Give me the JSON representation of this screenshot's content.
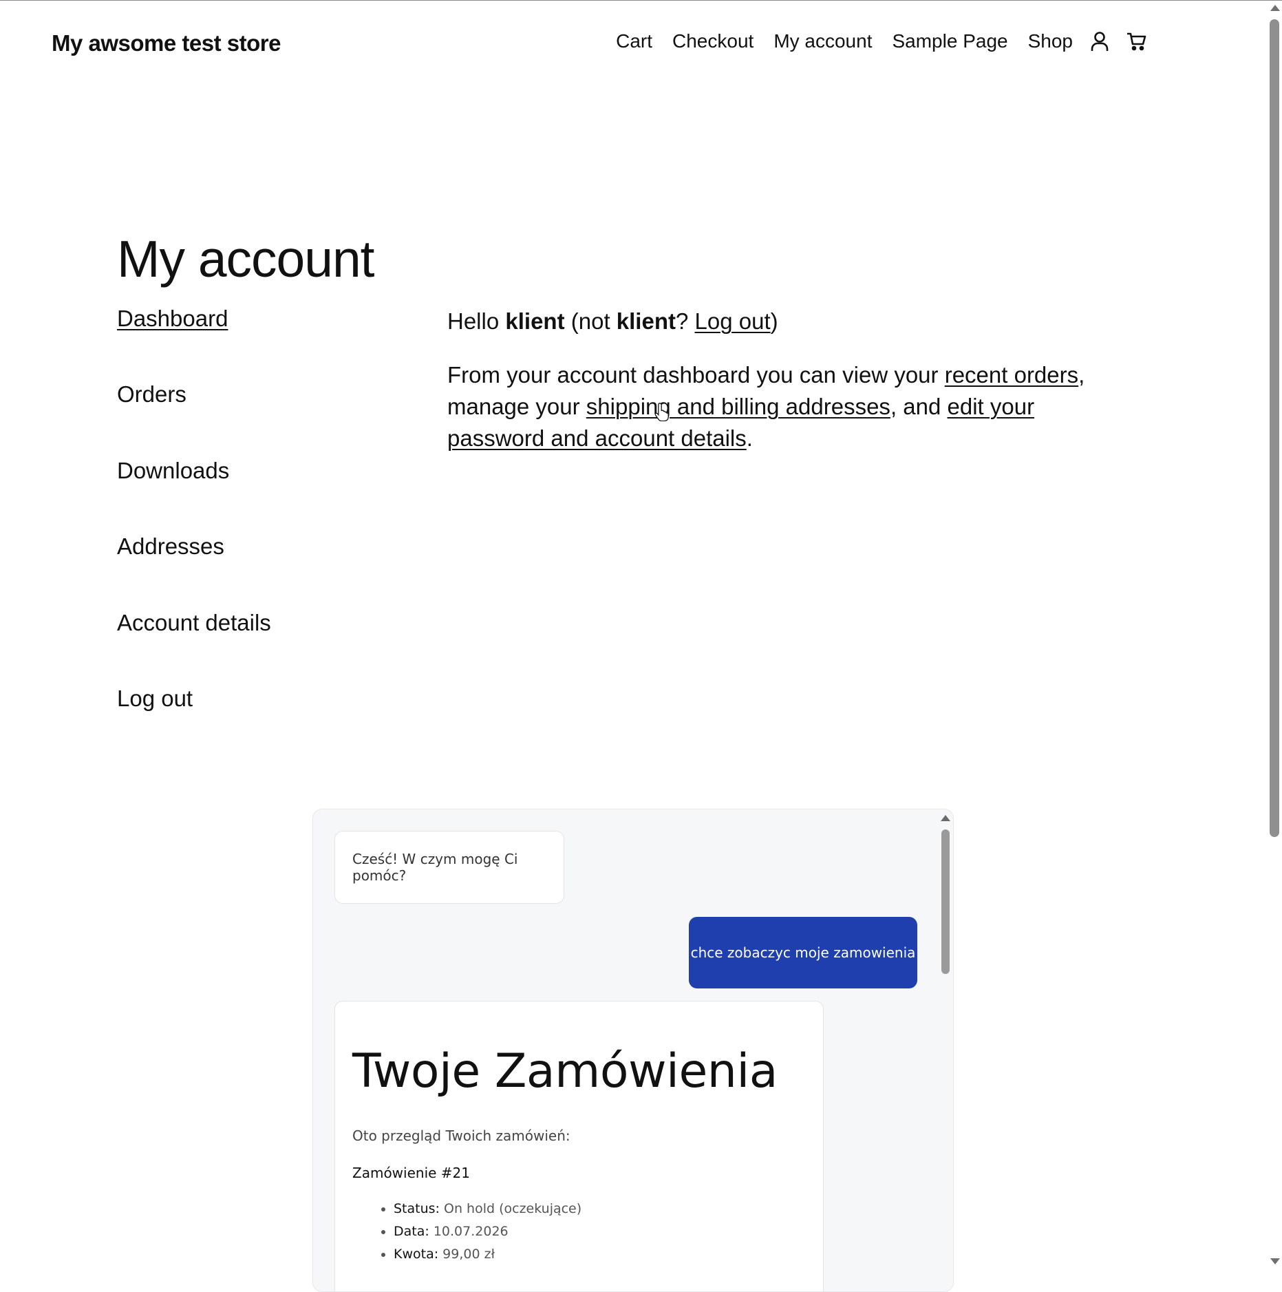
{
  "header": {
    "site_title": "My awsome test store",
    "nav": [
      "Cart",
      "Checkout",
      "My account",
      "Sample Page",
      "Shop"
    ],
    "icons": [
      "user-icon",
      "cart-icon"
    ]
  },
  "page": {
    "title": "My account"
  },
  "account_nav": {
    "items": [
      "Dashboard",
      "Orders",
      "Downloads",
      "Addresses",
      "Account details",
      "Log out"
    ],
    "active": "Dashboard"
  },
  "dashboard": {
    "hello": "Hello ",
    "username": "klient",
    "not_open": " (not ",
    "username2": "klient",
    "question": "? ",
    "logout_link": "Log out",
    "close_paren": ")",
    "text1": "From your account dashboard you can view your ",
    "recent_orders": "recent orders",
    "text2": ", manage your ",
    "addresses_link": "shipping and billing addresses",
    "text3": ", and ",
    "password_link": "edit your password and account details",
    "text4": "."
  },
  "chat": {
    "bot_greeting": "Cześć! W czym mogę Ci pomóc?",
    "user_message": "chce zobaczyc moje zamowienia",
    "orders_title": "Twoje Zamówienia",
    "orders_intro": "Oto przegląd Twoich zamówień:",
    "order_number": "Zamówienie #21",
    "order_fields": [
      {
        "label": "Status:",
        "value": "On hold (oczekujące)"
      },
      {
        "label": "Data:",
        "value": "10.07.2026"
      },
      {
        "label": "Kwota:",
        "value": "99,00 zł"
      }
    ],
    "user_bubble_color": "#1e3fad"
  }
}
